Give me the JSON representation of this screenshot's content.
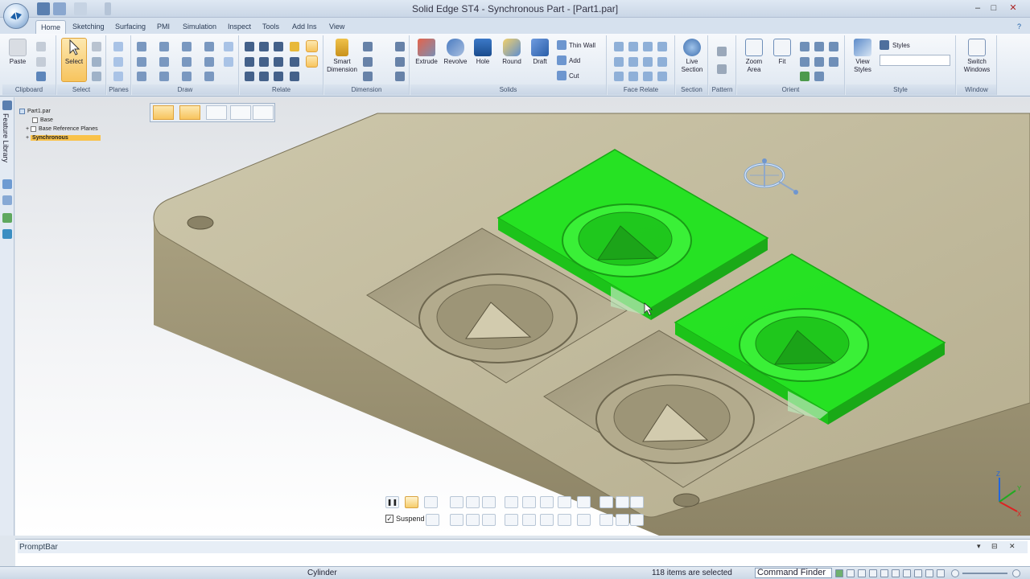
{
  "window": {
    "title": "Solid Edge ST4 - Synchronous Part - [Part1.par]",
    "minimize": "–",
    "maximize": "□",
    "close": "✕"
  },
  "ribbon_tabs": [
    "Home",
    "Sketching",
    "Surfacing",
    "PMI",
    "Simulation",
    "Inspect",
    "Tools",
    "Add Ins",
    "View"
  ],
  "ribbon_groups": {
    "clipboard": {
      "label": "Clipboard",
      "paste": "Paste"
    },
    "select": {
      "label": "Select",
      "select": "Select"
    },
    "planes": {
      "label": "Planes"
    },
    "draw": {
      "label": "Draw"
    },
    "relate": {
      "label": "Relate"
    },
    "dimension": {
      "label": "Dimension",
      "smart": "Smart Dimension"
    },
    "solids": {
      "label": "Solids",
      "extrude": "Extrude",
      "revolve": "Revolve",
      "hole": "Hole",
      "round": "Round",
      "draft": "Draft",
      "thin_wall": "Thin Wall",
      "add": "Add",
      "cut": "Cut"
    },
    "face_relate": {
      "label": "Face Relate"
    },
    "section": {
      "label": "Section",
      "live_section": "Live Section"
    },
    "pattern": {
      "label": "Pattern"
    },
    "orient": {
      "label": "Orient",
      "zoom_area": "Zoom Area",
      "fit": "Fit"
    },
    "style": {
      "label": "Style",
      "view_styles": "View Styles",
      "styles": "Styles"
    },
    "window": {
      "label": "Window",
      "switch_windows": "Switch Windows"
    }
  },
  "sidebar": {
    "feature_library": "Feature Library"
  },
  "tree": {
    "root": "Part1.par",
    "items": [
      "Base",
      "Base Reference Planes",
      "Synchronous"
    ]
  },
  "command_bar": {
    "suspend": "Suspend",
    "suspend_checked": true
  },
  "promptbar": {
    "title": "PromptBar"
  },
  "status": {
    "selected_name": "Cylinder",
    "selection_count": "118 items are selected",
    "command_finder": "Command Finder"
  },
  "triad": {
    "x": "X",
    "y": "Y",
    "z": "Z"
  },
  "colors": {
    "highlight_green": "#19e619",
    "part_body": "#c2bb9c",
    "ribbon_bg": "#e6edf5",
    "accent_orange": "#f7c45e"
  }
}
